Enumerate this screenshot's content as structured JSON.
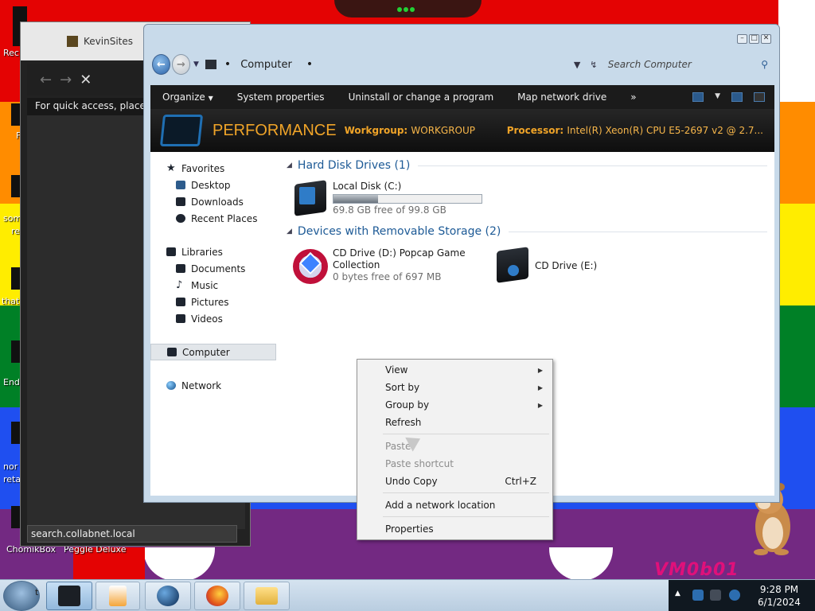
{
  "desktop": {
    "icon_labels": [
      "Rec",
      "F",
      "som",
      "re",
      "that",
      "End",
      "nor",
      "reta",
      "ChomikBox",
      "Peggle Deluxe"
    ],
    "watermark": "VM0b01"
  },
  "back_window": {
    "title": "KevinSites",
    "hint": "For quick access, place yo",
    "status": "search.collabnet.local",
    "back_arrow": "←",
    "fwd_arrow": "→",
    "close": "✕"
  },
  "explorer": {
    "address": {
      "location": "Computer",
      "search_placeholder": "Search Computer"
    },
    "toolbar": {
      "items": [
        "Organize",
        "System properties",
        "Uninstall or change a program",
        "Map network drive"
      ],
      "more": "»"
    },
    "banner": {
      "title": "PERFORMANCE",
      "workgroup_label": "Workgroup:",
      "workgroup_value": "WORKGROUP",
      "processor_label": "Processor:",
      "processor_value": "Intel(R) Xeon(R) CPU E5-2697 v2 @ 2.7..."
    },
    "nav": {
      "favorites": {
        "label": "Favorites",
        "items": [
          "Desktop",
          "Downloads",
          "Recent Places"
        ]
      },
      "libraries": {
        "label": "Libraries",
        "items": [
          "Documents",
          "Music",
          "Pictures",
          "Videos"
        ]
      },
      "computer": "Computer",
      "network": "Network"
    },
    "sections": {
      "hdd": "Hard Disk Drives (1)",
      "removable": "Devices with Removable Storage (2)"
    },
    "drives": {
      "c": {
        "name": "Local Disk (C:)",
        "free": "69.8 GB free of 99.8 GB",
        "used_fraction": 0.3
      },
      "d": {
        "name_line1": "CD Drive (D:) Popcap Game",
        "name_line2": "Collection",
        "free": "0 bytes free of 697 MB"
      },
      "e": {
        "name": "CD Drive (E:)"
      }
    }
  },
  "context_menu": {
    "view": "View",
    "sort_by": "Sort by",
    "group_by": "Group by",
    "refresh": "Refresh",
    "paste": "Paste",
    "paste_shortcut": "Paste shortcut",
    "undo_copy": "Undo Copy",
    "undo_shortcut": "Ctrl+Z",
    "add_network_location": "Add a network location",
    "properties": "Properties"
  },
  "taskbar": {
    "start_suffix": "t",
    "time": "9:28 PM",
    "date": "6/1/2024"
  },
  "colors": {
    "banner_accent": "#f0a428",
    "section_header": "#1d5a96",
    "toolbar_bg": "#1b1b1b"
  }
}
